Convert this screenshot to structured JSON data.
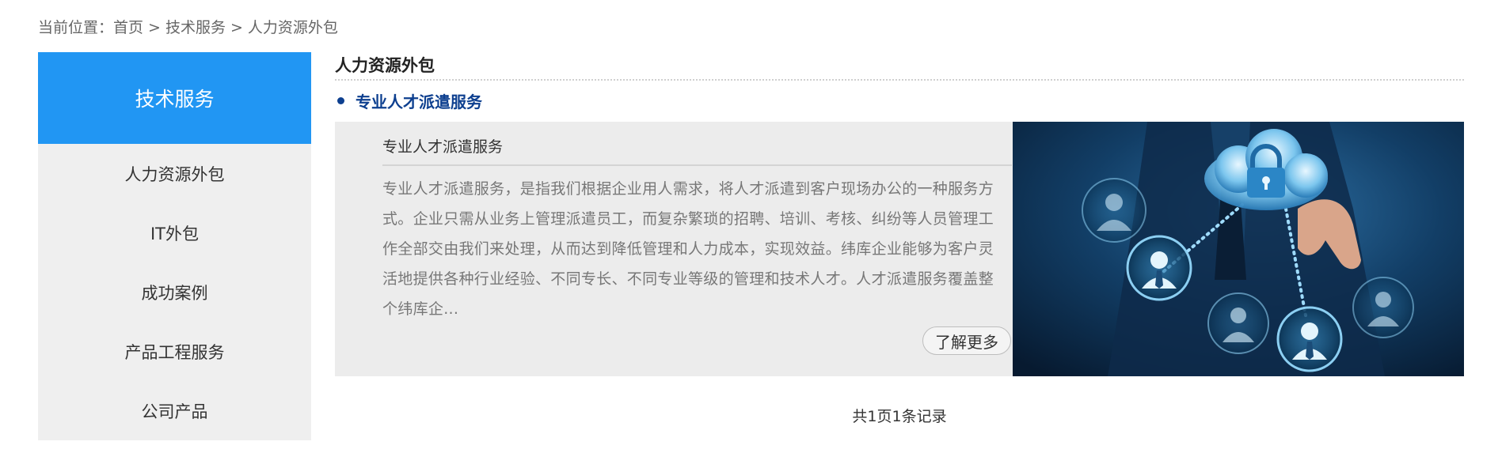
{
  "breadcrumb": {
    "prefix": "当前位置：",
    "items": [
      "首页",
      "技术服务",
      "人力资源外包"
    ],
    "separator": ">"
  },
  "sidebar": {
    "title": "技术服务",
    "items": [
      {
        "label": "人力资源外包"
      },
      {
        "label": "IT外包"
      },
      {
        "label": "成功案例"
      },
      {
        "label": "产品工程服务"
      },
      {
        "label": "公司产品"
      }
    ]
  },
  "main": {
    "section_title": "人力资源外包",
    "sub_title": "专业人才派遣服务",
    "card": {
      "title": "专业人才派遣服务",
      "description": "专业人才派遣服务，是指我们根据企业用人需求，将人才派遣到客户现场办公的一种服务方式。企业只需从业务上管理派遣员工，而复杂繁琐的招聘、培训、考核、纠纷等人员管理工作全部交由我们来处理，从而达到降低管理和人力成本，实现效益。纬库企业能够为客户灵活地提供各种行业经验、不同专长、不同专业等级的管理和技术人才。人才派遣服务覆盖整个纬库企...",
      "more_label": "了解更多",
      "image_icon": "cloud-security-network-image"
    },
    "pagination": "共1页1条记录"
  },
  "colors": {
    "sidebar_accent": "#2196f3",
    "sub_title": "#0d3f8f",
    "card_bg": "#ececec"
  }
}
